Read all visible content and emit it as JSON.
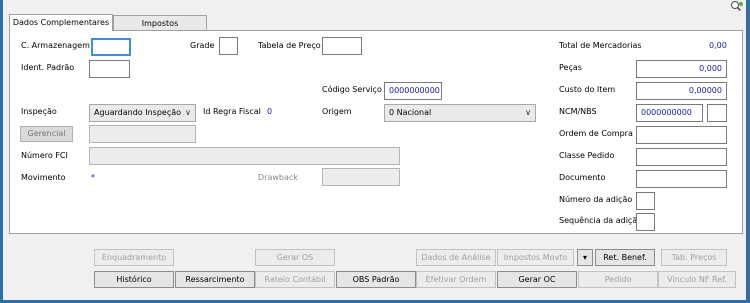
{
  "tabs": [
    "Dados Complementares",
    "Impostos"
  ],
  "fields": {
    "c_armazenagem": "C. Armazenagem",
    "grade": "Grade",
    "tabela_preco": "Tabela de Preço",
    "ident_padrao": "Ident. Padrão",
    "codigo_servico": "Código Serviço",
    "codigo_servico_value": "0000000000",
    "inspecao": "Inspeção",
    "inspecao_value": "Aguardando Inspeção",
    "id_regra_fiscal": "Id Regra Fiscal",
    "id_regra_fiscal_value": "0",
    "origem": "Origem",
    "origem_value": "0 Nacional",
    "gerencial": "Gerencial",
    "numero_fci": "Número FCI",
    "movimento": "Movimento",
    "movimento_value": "*",
    "drawback": "Drawback"
  },
  "right": {
    "total_mercadorias": "Total de Mercadorias",
    "total_mercadorias_value": "0,00",
    "pecas": "Peças",
    "pecas_value": "0,000",
    "custo_item": "Custo do Item",
    "custo_item_value": "0,00000",
    "ncm_nbs": "NCM/NBS",
    "ncm_nbs_value": "0000000000",
    "ordem_compra": "Ordem de Compra",
    "classe_pedido": "Classe Pedido",
    "documento": "Documento",
    "numero_adicao": "Número da adição",
    "sequencia_adicao": "Sequência da adição"
  },
  "buttons_row1": {
    "enquadramento": "Enquadramento",
    "gerar_os": "Gerar OS",
    "dados_analise": "Dados de Análise",
    "impostos_movto": "Impostos Movto",
    "dropdown": "▾",
    "ret_benef": "Ret. Benef.",
    "tab_precos": "Tab. Preços"
  },
  "buttons_row2": {
    "historico": "Histórico",
    "ressarcimento": "Ressarcimento",
    "rateio_contabil": "Rateio Contábil",
    "obs_padrao": "OBS Padrão",
    "efetivar_ordem": "Efetivar Ordem",
    "gerar_oc": "Gerar OC",
    "pedido": "Pedido",
    "vinculo_nf_ref": "Vinculo NF Ref."
  },
  "colors": {
    "value_text": "#1a1a9a",
    "focus_border": "#3b8ee0",
    "desktop_bg": "#2f6fa8"
  },
  "icons": {
    "top_right": "search-refresh-icon"
  }
}
